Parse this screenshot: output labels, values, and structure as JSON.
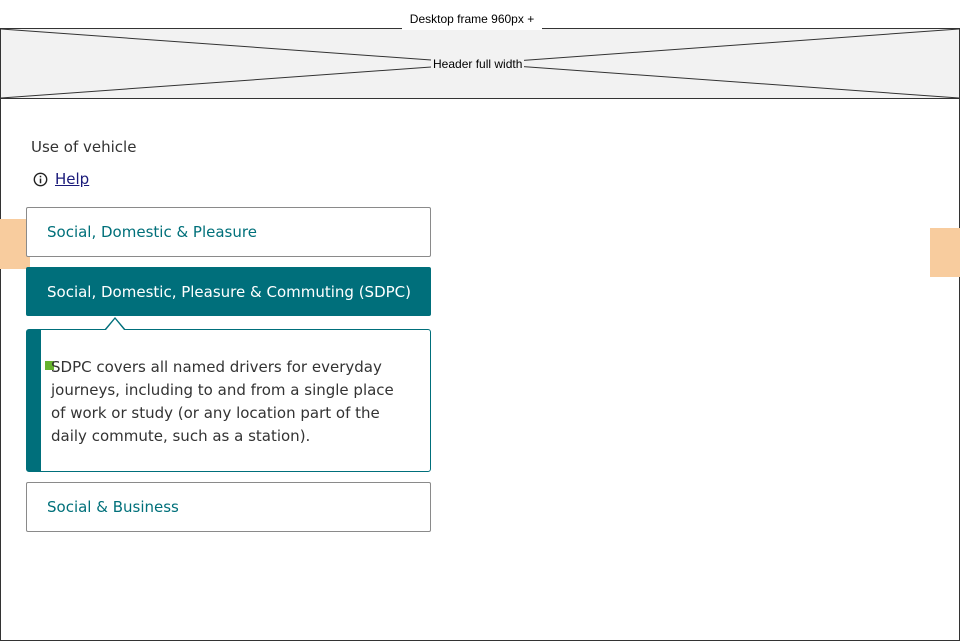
{
  "frame": {
    "label": "Desktop frame 960px +",
    "header_label": "Header full width"
  },
  "form": {
    "label": "Use of vehicle",
    "help_label": "Help",
    "help_icon": "info-circle-icon",
    "options": [
      {
        "label": "Social, Domestic & Pleasure",
        "selected": false
      },
      {
        "label": "Social, Domestic, Pleasure & Commuting (SDPC)",
        "selected": true
      },
      {
        "label": "Social & Business",
        "selected": false
      }
    ],
    "info_text": "SDPC covers all named drivers for everyday journeys, including to and from a single place of work or study (or any location part of the daily commute, such as a station)."
  },
  "colors": {
    "accent": "#006f7b",
    "accent_text": "#00707a",
    "marker": "#66b32e",
    "placeholder": "#f8cc9e",
    "header_bg": "#f2f2f2"
  }
}
